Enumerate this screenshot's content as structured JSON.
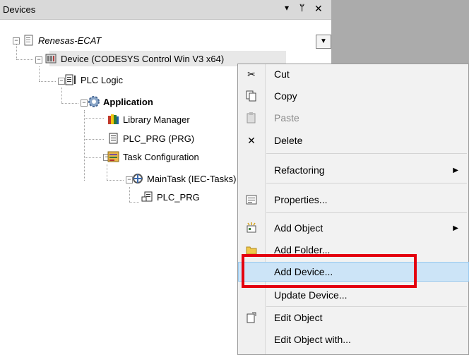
{
  "panel": {
    "title": "Devices",
    "controls": {
      "dropdown": "▾",
      "pin": "ᛘ",
      "close": "✕"
    }
  },
  "tree": {
    "project": {
      "label": "Renesas-ECAT",
      "icon": "project-icon"
    },
    "device": {
      "label": "Device (CODESYS Control Win V3 x64)",
      "icon": "device-icon"
    },
    "plc_logic": {
      "label": "PLC Logic",
      "icon": "plc-logic-icon"
    },
    "application": {
      "label": "Application",
      "icon": "application-gear-icon"
    },
    "library_manager": {
      "label": "Library Manager",
      "icon": "library-books-icon"
    },
    "plc_prg_prg": {
      "label": "PLC_PRG (PRG)",
      "icon": "program-icon"
    },
    "task_configuration": {
      "label": "Task Configuration",
      "icon": "task-config-icon"
    },
    "main_task": {
      "label": "MainTask (IEC-Tasks)",
      "icon": "task-icon"
    },
    "plc_prg": {
      "label": "PLC_PRG",
      "icon": "program-call-icon"
    }
  },
  "context_menu": {
    "items": [
      {
        "label": "Cut",
        "icon": "scissors-icon"
      },
      {
        "label": "Copy",
        "icon": "copy-icon"
      },
      {
        "label": "Paste",
        "icon": "paste-icon",
        "disabled": true
      },
      {
        "label": "Delete",
        "icon": "delete-icon"
      },
      {
        "label": "Refactoring",
        "submenu": true
      },
      {
        "label": "Properties...",
        "icon": "properties-icon"
      },
      {
        "label": "Add Object",
        "icon": "add-object-icon",
        "submenu": true
      },
      {
        "label": "Add Folder...",
        "icon": "folder-icon"
      },
      {
        "label": "Add Device...",
        "highlighted": true
      },
      {
        "label": "Update Device..."
      },
      {
        "label": "Edit Object",
        "icon": "edit-object-icon"
      },
      {
        "label": "Edit Object with..."
      }
    ]
  },
  "colors": {
    "highlight": "#cce4f7",
    "annotation_box": "#e4000f",
    "background": "#ababab"
  }
}
